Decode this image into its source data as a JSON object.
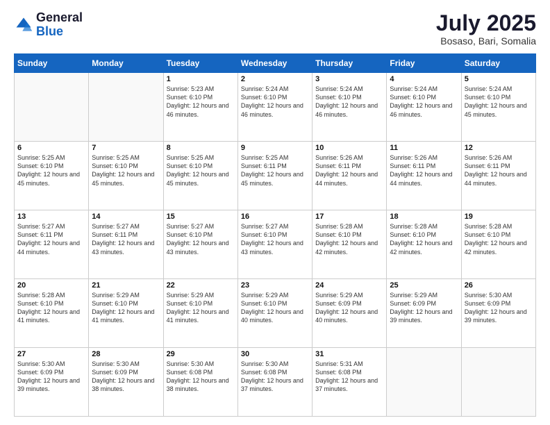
{
  "logo": {
    "general": "General",
    "blue": "Blue"
  },
  "header": {
    "month_year": "July 2025",
    "location": "Bosaso, Bari, Somalia"
  },
  "weekdays": [
    "Sunday",
    "Monday",
    "Tuesday",
    "Wednesday",
    "Thursday",
    "Friday",
    "Saturday"
  ],
  "weeks": [
    [
      {
        "day": "",
        "info": ""
      },
      {
        "day": "",
        "info": ""
      },
      {
        "day": "1",
        "info": "Sunrise: 5:23 AM\nSunset: 6:10 PM\nDaylight: 12 hours and 46 minutes."
      },
      {
        "day": "2",
        "info": "Sunrise: 5:24 AM\nSunset: 6:10 PM\nDaylight: 12 hours and 46 minutes."
      },
      {
        "day": "3",
        "info": "Sunrise: 5:24 AM\nSunset: 6:10 PM\nDaylight: 12 hours and 46 minutes."
      },
      {
        "day": "4",
        "info": "Sunrise: 5:24 AM\nSunset: 6:10 PM\nDaylight: 12 hours and 46 minutes."
      },
      {
        "day": "5",
        "info": "Sunrise: 5:24 AM\nSunset: 6:10 PM\nDaylight: 12 hours and 45 minutes."
      }
    ],
    [
      {
        "day": "6",
        "info": "Sunrise: 5:25 AM\nSunset: 6:10 PM\nDaylight: 12 hours and 45 minutes."
      },
      {
        "day": "7",
        "info": "Sunrise: 5:25 AM\nSunset: 6:10 PM\nDaylight: 12 hours and 45 minutes."
      },
      {
        "day": "8",
        "info": "Sunrise: 5:25 AM\nSunset: 6:10 PM\nDaylight: 12 hours and 45 minutes."
      },
      {
        "day": "9",
        "info": "Sunrise: 5:25 AM\nSunset: 6:11 PM\nDaylight: 12 hours and 45 minutes."
      },
      {
        "day": "10",
        "info": "Sunrise: 5:26 AM\nSunset: 6:11 PM\nDaylight: 12 hours and 44 minutes."
      },
      {
        "day": "11",
        "info": "Sunrise: 5:26 AM\nSunset: 6:11 PM\nDaylight: 12 hours and 44 minutes."
      },
      {
        "day": "12",
        "info": "Sunrise: 5:26 AM\nSunset: 6:11 PM\nDaylight: 12 hours and 44 minutes."
      }
    ],
    [
      {
        "day": "13",
        "info": "Sunrise: 5:27 AM\nSunset: 6:11 PM\nDaylight: 12 hours and 44 minutes."
      },
      {
        "day": "14",
        "info": "Sunrise: 5:27 AM\nSunset: 6:11 PM\nDaylight: 12 hours and 43 minutes."
      },
      {
        "day": "15",
        "info": "Sunrise: 5:27 AM\nSunset: 6:10 PM\nDaylight: 12 hours and 43 minutes."
      },
      {
        "day": "16",
        "info": "Sunrise: 5:27 AM\nSunset: 6:10 PM\nDaylight: 12 hours and 43 minutes."
      },
      {
        "day": "17",
        "info": "Sunrise: 5:28 AM\nSunset: 6:10 PM\nDaylight: 12 hours and 42 minutes."
      },
      {
        "day": "18",
        "info": "Sunrise: 5:28 AM\nSunset: 6:10 PM\nDaylight: 12 hours and 42 minutes."
      },
      {
        "day": "19",
        "info": "Sunrise: 5:28 AM\nSunset: 6:10 PM\nDaylight: 12 hours and 42 minutes."
      }
    ],
    [
      {
        "day": "20",
        "info": "Sunrise: 5:28 AM\nSunset: 6:10 PM\nDaylight: 12 hours and 41 minutes."
      },
      {
        "day": "21",
        "info": "Sunrise: 5:29 AM\nSunset: 6:10 PM\nDaylight: 12 hours and 41 minutes."
      },
      {
        "day": "22",
        "info": "Sunrise: 5:29 AM\nSunset: 6:10 PM\nDaylight: 12 hours and 41 minutes."
      },
      {
        "day": "23",
        "info": "Sunrise: 5:29 AM\nSunset: 6:10 PM\nDaylight: 12 hours and 40 minutes."
      },
      {
        "day": "24",
        "info": "Sunrise: 5:29 AM\nSunset: 6:09 PM\nDaylight: 12 hours and 40 minutes."
      },
      {
        "day": "25",
        "info": "Sunrise: 5:29 AM\nSunset: 6:09 PM\nDaylight: 12 hours and 39 minutes."
      },
      {
        "day": "26",
        "info": "Sunrise: 5:30 AM\nSunset: 6:09 PM\nDaylight: 12 hours and 39 minutes."
      }
    ],
    [
      {
        "day": "27",
        "info": "Sunrise: 5:30 AM\nSunset: 6:09 PM\nDaylight: 12 hours and 39 minutes."
      },
      {
        "day": "28",
        "info": "Sunrise: 5:30 AM\nSunset: 6:09 PM\nDaylight: 12 hours and 38 minutes."
      },
      {
        "day": "29",
        "info": "Sunrise: 5:30 AM\nSunset: 6:08 PM\nDaylight: 12 hours and 38 minutes."
      },
      {
        "day": "30",
        "info": "Sunrise: 5:30 AM\nSunset: 6:08 PM\nDaylight: 12 hours and 37 minutes."
      },
      {
        "day": "31",
        "info": "Sunrise: 5:31 AM\nSunset: 6:08 PM\nDaylight: 12 hours and 37 minutes."
      },
      {
        "day": "",
        "info": ""
      },
      {
        "day": "",
        "info": ""
      }
    ]
  ]
}
